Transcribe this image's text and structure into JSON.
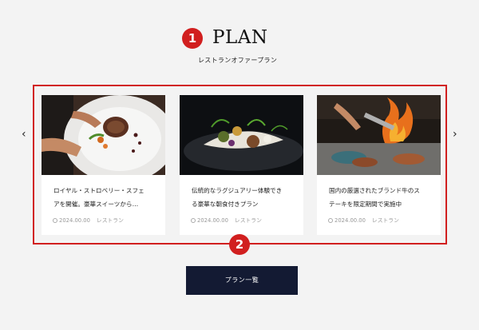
{
  "section": {
    "marker1": "1",
    "title": "PLAN",
    "subtitle": "レストランオファープラン",
    "marker2": "2"
  },
  "carousel": {
    "prev_icon": "chevron-left-icon",
    "next_icon": "chevron-right-icon",
    "cards": [
      {
        "line1": "ロイヤル・ストロベリー・スフェ",
        "line2": "アを開催。豪華スイーツから…",
        "date": "2024.00.00",
        "category": "レストラン"
      },
      {
        "line1": "伝統的なラグジュアリー体験でき",
        "line2": "る豪華な朝食付きプラン",
        "date": "2024.00.00",
        "category": "レストラン"
      },
      {
        "line1": "国内の厳選されたブランド牛のス",
        "line2": "テーキを限定期間で実施中",
        "date": "2024.00.00",
        "category": "レストラン"
      }
    ]
  },
  "button": {
    "label": "プラン一覧"
  },
  "colors": {
    "accent": "#d11f1f",
    "button_bg": "#131a33",
    "background": "#f3f3f3"
  }
}
